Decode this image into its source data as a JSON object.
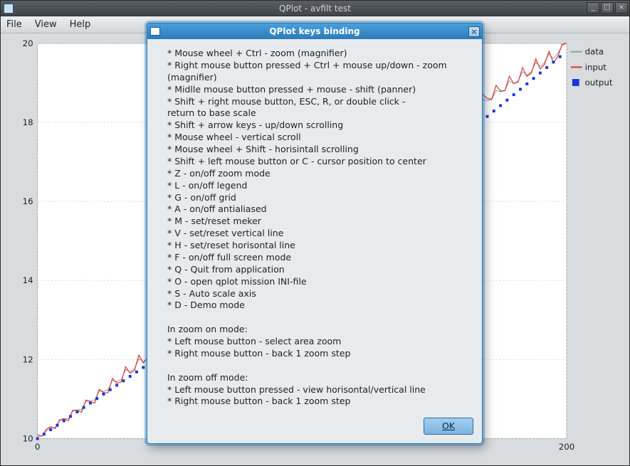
{
  "main_window": {
    "title": "QPlot - avfilt test",
    "menu": [
      "File",
      "View",
      "Help"
    ]
  },
  "legend": {
    "items": [
      {
        "label": "data",
        "color": "#9a9a8b",
        "type": "line"
      },
      {
        "label": "input",
        "color": "#d23a3a",
        "type": "line"
      },
      {
        "label": "output",
        "color": "#1936d6",
        "type": "square"
      }
    ]
  },
  "chart_data": {
    "type": "line",
    "xlabel": "",
    "ylabel": "",
    "xlim": [
      0,
      200
    ],
    "ylim": [
      10,
      20
    ],
    "xticks": [
      0,
      200
    ],
    "yticks": [
      10,
      12,
      14,
      16,
      18,
      20
    ],
    "series": [
      {
        "name": "data",
        "color": "#9a9a8b",
        "style": "line",
        "x": [
          0,
          10,
          20,
          30,
          40,
          50,
          60,
          70,
          80,
          90,
          100,
          110,
          120,
          130,
          140,
          150,
          160,
          170,
          180,
          190,
          200
        ],
        "y": [
          10.05,
          10.55,
          11.05,
          11.55,
          12.05,
          12.55,
          13.05,
          13.55,
          14.05,
          14.55,
          15.05,
          15.55,
          16.05,
          16.55,
          17.05,
          17.55,
          18.05,
          18.55,
          19.05,
          19.55,
          20.0
        ]
      },
      {
        "name": "input",
        "color": "#d23a3a",
        "style": "noisy",
        "x": [
          0,
          10,
          20,
          30,
          40,
          50,
          60,
          70,
          80,
          90,
          100,
          110,
          120,
          130,
          140,
          150,
          160,
          170,
          180,
          190,
          200
        ],
        "y": [
          10.1,
          10.6,
          11.1,
          11.6,
          12.1,
          12.6,
          13.1,
          13.6,
          14.1,
          14.6,
          15.1,
          15.6,
          16.1,
          16.6,
          17.1,
          17.6,
          18.1,
          18.6,
          19.1,
          19.6,
          20.0
        ]
      },
      {
        "name": "output",
        "color": "#1936d6",
        "style": "dotted",
        "x": [
          0,
          10,
          20,
          30,
          40,
          50,
          60,
          70,
          80,
          90,
          100,
          110,
          120,
          130,
          140,
          150,
          160,
          170,
          180,
          190,
          200
        ],
        "y": [
          10.0,
          10.45,
          10.9,
          11.35,
          11.8,
          12.25,
          12.7,
          13.15,
          13.65,
          14.15,
          14.65,
          15.15,
          15.65,
          16.15,
          16.65,
          17.15,
          17.65,
          18.15,
          18.7,
          19.25,
          19.8
        ]
      }
    ]
  },
  "dialog": {
    "title": "QPlot keys binding",
    "lines": [
      " * Mouse wheel + Ctrl - zoom (magnifier)",
      " * Right mouse button pressed + Ctrl + mouse up/down - zoom (magnifier)",
      " * Midlle mouse button pressed + mouse - shift (panner)",
      " * Shift + right mouse button, ESC, R,  or double click -",
      "    return to base scale",
      " * Shift + arrow keys - up/down scrolling",
      " * Mouse wheel - vertical scroll",
      " * Mouse wheel + Shift - horisintall scrolling",
      " * Shift + left mouse button or C - cursor position to center",
      " * Z - on/off zoom mode",
      " * L - on/off legend",
      " * G - on/off grid",
      " * A - on/off antialiased",
      " * M - set/reset meker",
      " * V - set/reset vertical line",
      " * H - set/reset horisontal line",
      " * F - on/off full screen mode",
      " * Q - Quit from application",
      " * O - open qplot mission INI-file",
      " * S - Auto scale axis",
      " * D - Demo mode",
      "",
      "In zoom on mode:",
      " * Left mouse button - select area zoom",
      " * Right mouse button - back 1 zoom step",
      "",
      "In zoom off mode:",
      " * Left mouse button pressed - view horisontal/vertical line",
      " * Right mouse button - back 1 zoom step"
    ],
    "ok_label": "OK"
  }
}
